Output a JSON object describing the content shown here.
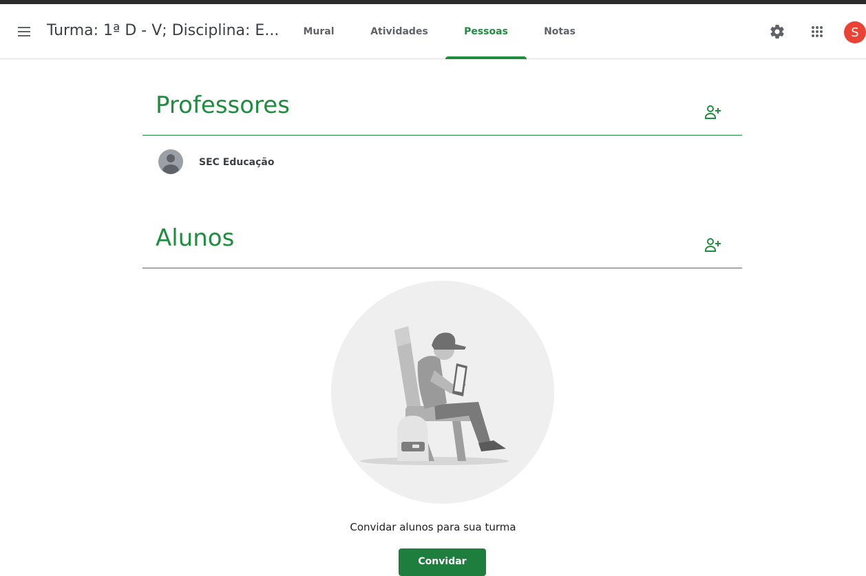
{
  "header": {
    "class_title": "Turma: 1ª D - V; Disciplina: E...",
    "tabs": [
      {
        "label": "Mural",
        "active": false
      },
      {
        "label": "Atividades",
        "active": false
      },
      {
        "label": "Pessoas",
        "active": true
      },
      {
        "label": "Notas",
        "active": false
      }
    ],
    "avatar_initial": "S",
    "icons": {
      "menu": "hamburger-menu-icon",
      "settings": "gear-icon",
      "apps": "grid-apps-icon"
    }
  },
  "teachers": {
    "title": "Professores",
    "add_icon": "add-person-icon",
    "people": [
      {
        "name": "SEC Educação"
      }
    ]
  },
  "students": {
    "title": "Alunos",
    "add_icon": "add-person-icon",
    "empty_message": "Convidar alunos para sua turma",
    "invite_label": "Convidar"
  },
  "colors": {
    "accent": "#1e8e3e",
    "avatar": "#ea4335",
    "text": "#3c4043"
  }
}
